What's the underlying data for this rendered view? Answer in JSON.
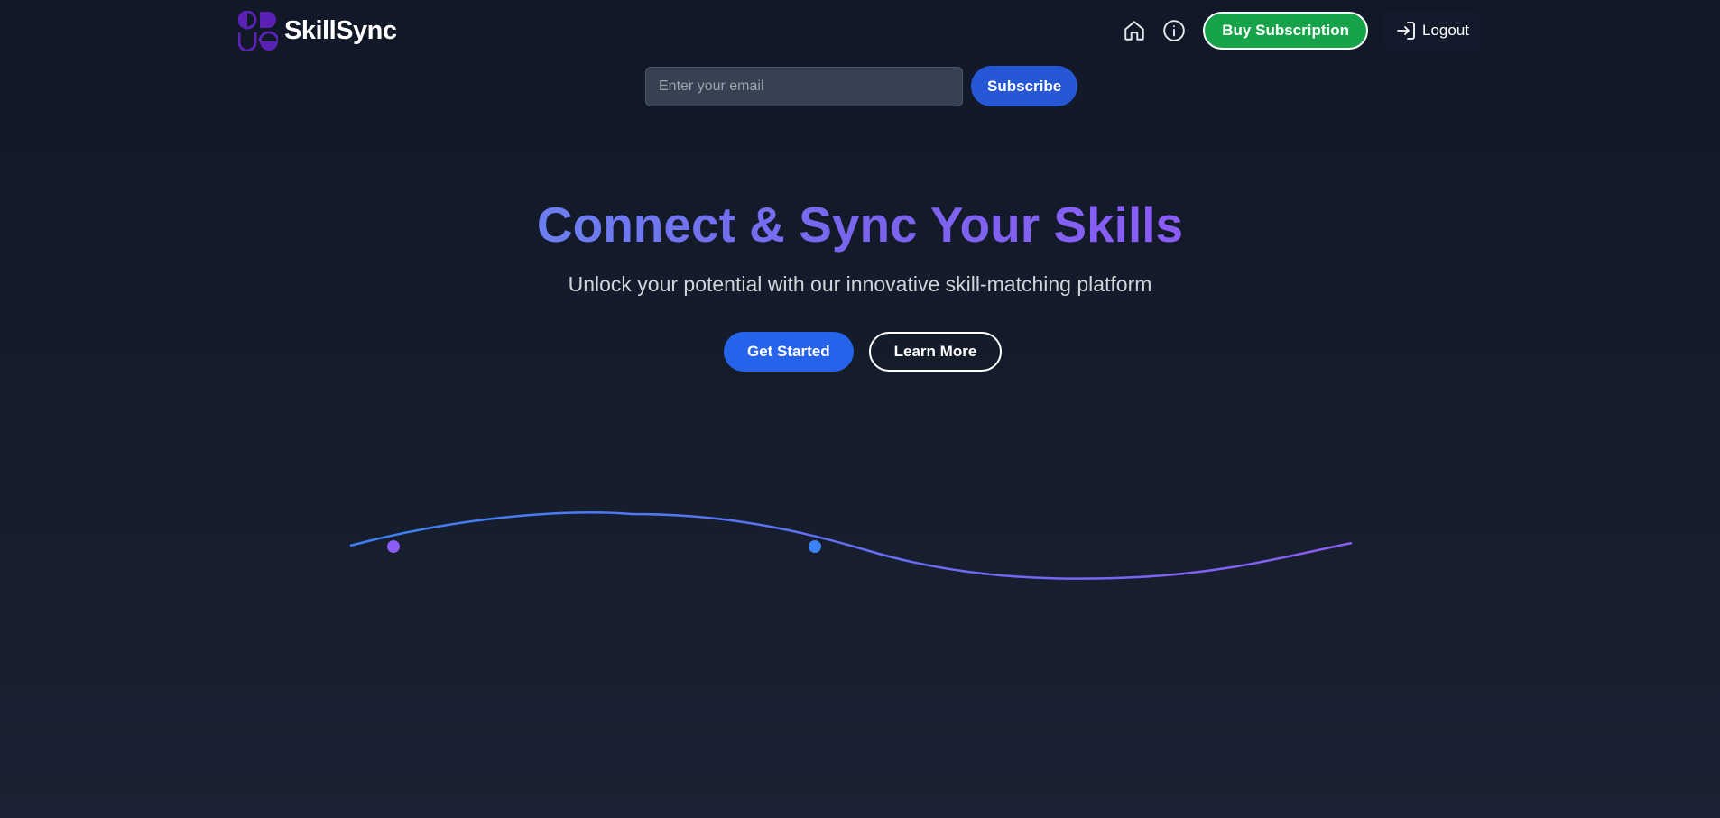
{
  "brand": {
    "name": "SkillSync",
    "logo_icon": "skillsync-logo-icon",
    "logo_color": "#5b21b6"
  },
  "nav": {
    "home_icon": "home-icon",
    "info_icon": "info-icon",
    "buy_subscription_label": "Buy Subscription",
    "logout_label": "Logout",
    "logout_icon": "login-arrow-icon"
  },
  "subscribe": {
    "email_placeholder": "Enter your email",
    "email_value": "",
    "button_label": "Subscribe"
  },
  "hero": {
    "title": "Connect & Sync Your Skills",
    "subtitle": "Unlock your potential with our innovative skill-matching platform",
    "primary_cta": "Get Started",
    "secondary_cta": "Learn More"
  },
  "colors": {
    "background": "#111827",
    "buy_button": "#16a34a",
    "primary_button": "#2563eb",
    "wave_start": "#3b82f6",
    "wave_end": "#8b5cf6",
    "dot_purple": "#8b5cf6",
    "dot_blue": "#3b82f6"
  }
}
